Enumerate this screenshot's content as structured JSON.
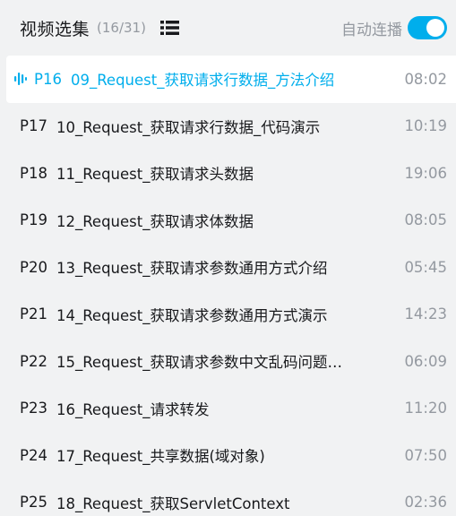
{
  "header": {
    "title": "视频选集",
    "count": "(16/31)",
    "autoplay_label": "自动连播",
    "autoplay_on": true
  },
  "colors": {
    "accent": "#00aeec",
    "muted": "#9499a0",
    "text": "#18191c",
    "background": "#f1f2f3",
    "active_background": "#ffffff"
  },
  "icons": {
    "list_view": "list-icon",
    "now_playing": "equalizer-bars-icon"
  },
  "episodes": [
    {
      "p": "P16",
      "title": "09_Request_获取请求行数据_方法介绍",
      "duration": "08:02",
      "active": true
    },
    {
      "p": "P17",
      "title": "10_Request_获取请求行数据_代码演示",
      "duration": "10:19",
      "active": false
    },
    {
      "p": "P18",
      "title": "11_Request_获取请求头数据",
      "duration": "19:06",
      "active": false
    },
    {
      "p": "P19",
      "title": "12_Request_获取请求体数据",
      "duration": "08:05",
      "active": false
    },
    {
      "p": "P20",
      "title": "13_Request_获取请求参数通用方式介绍",
      "duration": "05:45",
      "active": false
    },
    {
      "p": "P21",
      "title": "14_Request_获取请求参数通用方式演示",
      "duration": "14:23",
      "active": false
    },
    {
      "p": "P22",
      "title": "15_Request_获取请求参数中文乱码问题…",
      "duration": "06:09",
      "active": false
    },
    {
      "p": "P23",
      "title": "16_Request_请求转发",
      "duration": "11:20",
      "active": false
    },
    {
      "p": "P24",
      "title": "17_Request_共享数据(域对象)",
      "duration": "07:50",
      "active": false
    },
    {
      "p": "P25",
      "title": "18_Request_获取ServletContext",
      "duration": "02:36",
      "active": false
    }
  ]
}
